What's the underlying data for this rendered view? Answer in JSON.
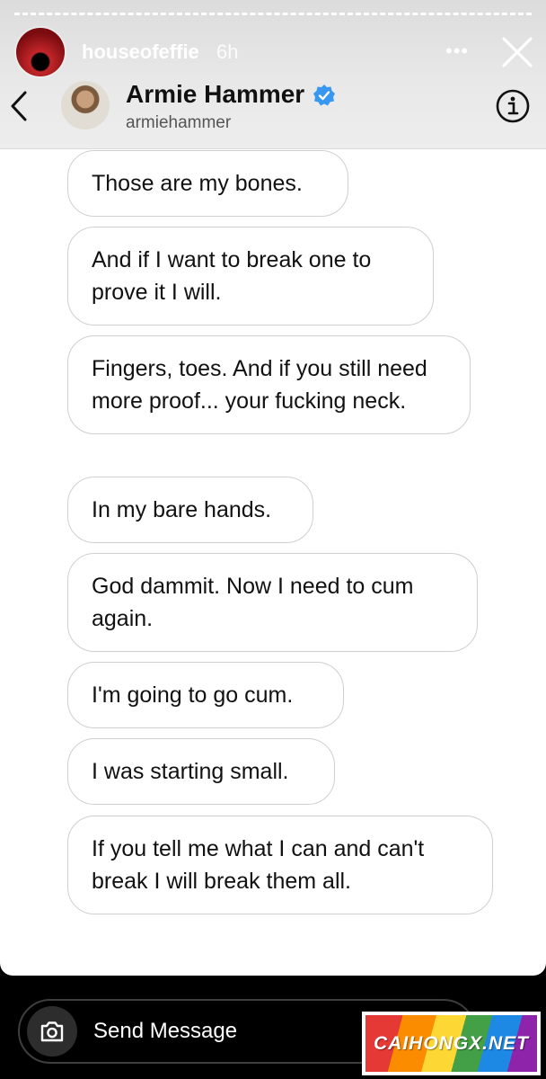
{
  "story": {
    "username": "houseofeffie",
    "time": "6h",
    "more_icon": "more-dots-icon",
    "close_icon": "close-icon"
  },
  "chat": {
    "contact_name": "Armie Hammer",
    "handle": "armiehammer",
    "verified": true,
    "accent_color": "#3897f0",
    "back_icon": "chevron-left-icon",
    "info_icon": "info-icon"
  },
  "messages": [
    "Those are my bones.",
    "And if I want to break one to prove it I will.",
    "Fingers, toes. And if you still need more proof... your fucking neck.",
    "In my bare hands.",
    "God dammit. Now I need to cum again.",
    "I'm going to go cum.",
    "I was starting small.",
    "If you tell me what I can and can't break I will break them all."
  ],
  "composer": {
    "placeholder": "Send Message",
    "camera_icon": "camera-icon"
  },
  "watermark": "CAIHONGX.NET"
}
